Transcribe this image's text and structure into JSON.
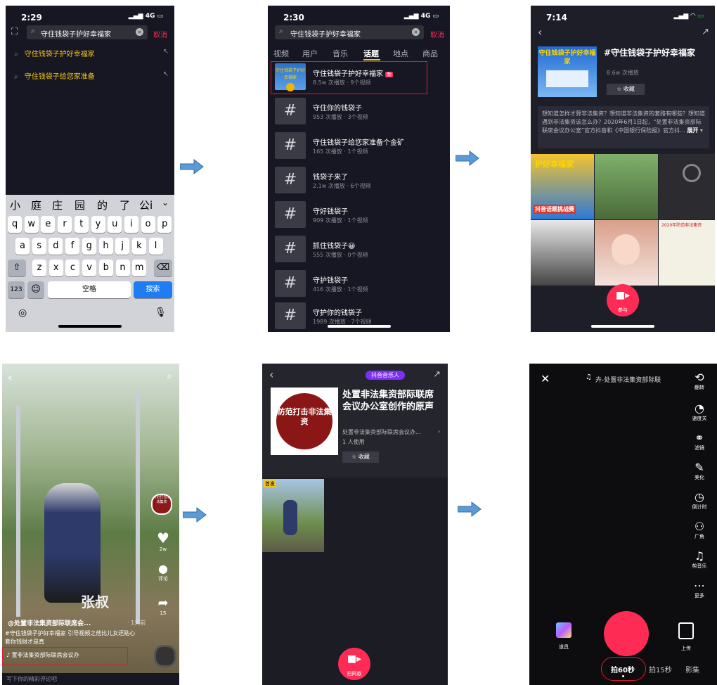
{
  "arrow_color": "#5b9bd5",
  "p1": {
    "time": "2:29",
    "signal": "4G",
    "query": "守住钱袋子护好幸福家",
    "cancel": "取消",
    "suggestions": [
      "守住钱袋子护好幸福家",
      "守住钱袋子给您家准备"
    ],
    "candidates": [
      "小",
      "庭",
      "庄",
      "园",
      "的",
      "了",
      "公i"
    ],
    "row1": [
      "q",
      "w",
      "e",
      "r",
      "t",
      "y",
      "u",
      "i",
      "o",
      "p"
    ],
    "row2": [
      "a",
      "s",
      "d",
      "f",
      "g",
      "h",
      "j",
      "k",
      "l"
    ],
    "row3": [
      "z",
      "x",
      "c",
      "v",
      "b",
      "n",
      "m"
    ],
    "key_123": "123",
    "space": "空格",
    "search": "搜索"
  },
  "p2": {
    "time": "2:30",
    "signal": "4G",
    "query": "守住钱袋子护好幸福家",
    "cancel": "取消",
    "tabs": [
      "视频",
      "用户",
      "音乐",
      "话题",
      "地点",
      "商品"
    ],
    "topics": [
      {
        "title": "守住钱袋子护好幸福家",
        "badge": "新",
        "meta": "8.5w 次播放 · 9个视频"
      },
      {
        "title": "守住你的钱袋子",
        "meta": "953 次播放 · 3个视频"
      },
      {
        "title": "守住钱袋子给您家准备个金矿",
        "meta": "165 次播放 · 1个视频"
      },
      {
        "title": "钱袋子来了",
        "meta": "2.1w 次播放 · 6个视频"
      },
      {
        "title": "守好钱袋子",
        "meta": "909 次播放 · 1个视频"
      },
      {
        "title": "抓住钱袋子😀",
        "meta": "555 次播放 · 0个视频"
      },
      {
        "title": "守护钱袋子",
        "meta": "416 次播放 · 1个视频"
      },
      {
        "title": "守护你的钱袋子",
        "meta": "1989 次播放 · 7个视频"
      }
    ],
    "hash": "#",
    "thumb_text": "守住钱袋子护好幸福家"
  },
  "p3": {
    "time": "7:14",
    "title": "#守住钱袋子护好幸福家",
    "plays": "8.6w 次播放",
    "collect": "收藏",
    "thumb_text": "守住钱袋子护好幸福家",
    "desc": "想知道怎样才算非法集资？想知道非法集资的套路有哪些？想知道遇到非法集资该怎么办？2020年6月1日起，“处置非法集资部际联席会议办公室”官方抖音和《中国银行保险报》官方抖...",
    "expand": "展开",
    "grid_labels": [
      "护好幸福家",
      "抖音话题挑战赛",
      "2020年防范非法集资"
    ],
    "join": "参与"
  },
  "p4": {
    "watermark": "张叔",
    "author": "@处置非法集资部际联席会...",
    "time_ago": "· 1天前",
    "caption": "#守住钱袋子护好幸福家 引导视频之他比儿女还贴心 套你钱财才是真",
    "music": "♪ 置非法集资部际联席会议办",
    "comment_placeholder": "写下你的精彩评论吧",
    "likes": "2w",
    "comments_label": "评论",
    "shares": "15",
    "avatar_text": "防范打击非法集资"
  },
  "p5": {
    "badge": "抖音音乐人",
    "title": "处置非法集资部际联席会议办公室创作的原声",
    "author": "处置非法集资部际联席会议办...",
    "users": "1 人使用",
    "collect": "收藏",
    "cover_text": "防范打击非法集资",
    "first": "首发",
    "shoot": "拍同款"
  },
  "p6": {
    "music": "卉-处置非法集资部际联",
    "side": [
      {
        "icon": "flip-icon",
        "label": "翻转"
      },
      {
        "icon": "speed-icon",
        "label": "速度关"
      },
      {
        "icon": "filter-icon",
        "label": "滤镜"
      },
      {
        "icon": "beautify-icon",
        "label": "美化"
      },
      {
        "icon": "timer-icon",
        "label": "倒计时"
      },
      {
        "icon": "wide-angle-icon",
        "label": "广角"
      },
      {
        "icon": "cut-music-icon",
        "label": "剪音乐"
      },
      {
        "icon": "more-icon",
        "label": "更多"
      }
    ],
    "props": "道具",
    "upload": "上传",
    "modes": [
      "拍60秒",
      "拍15秒",
      "影集"
    ]
  }
}
